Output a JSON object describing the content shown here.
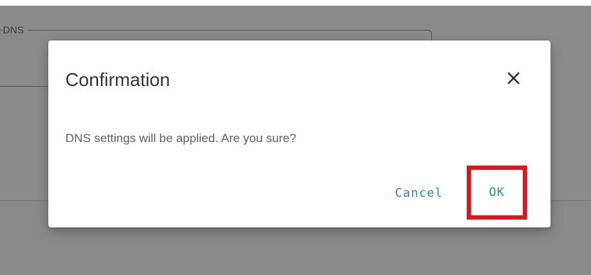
{
  "background_page": {
    "section_legend": "DNS"
  },
  "dialog": {
    "title": "Confirmation",
    "close_icon": "close-icon",
    "message": "DNS settings will be applied. Are you sure?",
    "actions": {
      "cancel_label": "Cancel",
      "ok_label": "OK"
    },
    "highlight": {
      "target": "ok-button",
      "color": "#e3151c"
    }
  },
  "colors": {
    "accent": "#2f7fd1",
    "overlay": "#8b8b8b",
    "title_text": "#333333",
    "body_text": "#5f5f5f"
  }
}
